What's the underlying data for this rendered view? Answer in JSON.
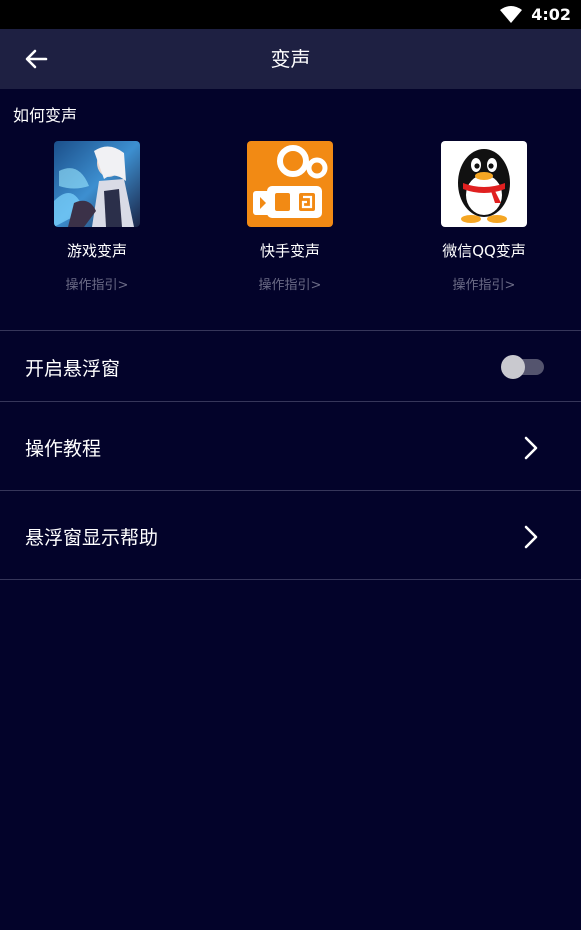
{
  "status_bar": {
    "time": "4:02"
  },
  "header": {
    "title": "变声"
  },
  "section": {
    "label": "如何变声"
  },
  "apps": [
    {
      "icon": "game-hero-icon",
      "name": "游戏变声",
      "guide": "操作指引>"
    },
    {
      "icon": "kuaishou-icon",
      "name": "快手变声",
      "guide": "操作指引>"
    },
    {
      "icon": "qq-penguin-icon",
      "name": "微信QQ变声",
      "guide": "操作指引>"
    }
  ],
  "settings": {
    "floating_window": {
      "label": "开启悬浮窗",
      "enabled": false
    },
    "tutorial": {
      "label": "操作教程"
    },
    "float_help": {
      "label": "悬浮窗显示帮助"
    }
  },
  "colors": {
    "background": "#03032a",
    "app_bar": "#1e2042",
    "divider": "#36365a",
    "kuaishou_orange": "#f28a14"
  }
}
